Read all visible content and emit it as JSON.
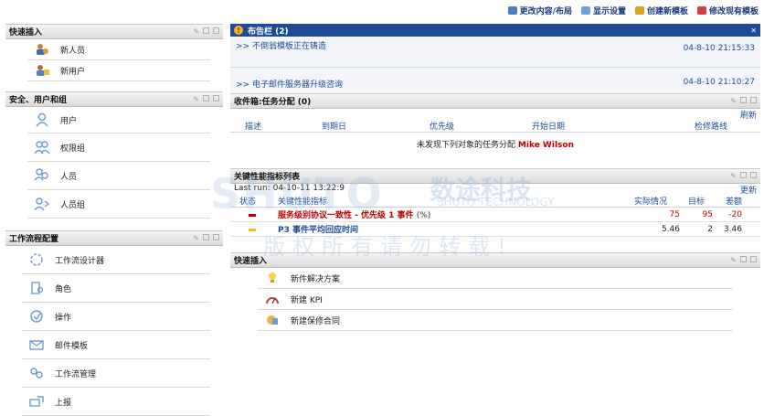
{
  "toplinks": [
    {
      "label": "更改内容/布局",
      "color": "#4a7bc4"
    },
    {
      "label": "显示设置",
      "color": "#6fa0d8"
    },
    {
      "label": "创建新模板",
      "color": "#e0a020"
    },
    {
      "label": "修改现有模板",
      "color": "#d04040"
    }
  ],
  "quick_insert_left": {
    "title": "快速插入",
    "items": [
      {
        "label": "新人员",
        "icon": "new-person-icon"
      },
      {
        "label": "新用户",
        "icon": "new-user-icon"
      }
    ]
  },
  "security": {
    "title": "安全、用户和组",
    "items": [
      {
        "label": "用户",
        "icon": "user-icon"
      },
      {
        "label": "权限组",
        "icon": "permission-group-icon"
      },
      {
        "label": "人员",
        "icon": "person-icon"
      },
      {
        "label": "人员组",
        "icon": "person-group-icon"
      }
    ]
  },
  "workflow": {
    "title": "工作流程配置",
    "items": [
      {
        "label": "工作流设计器",
        "icon": "workflow-designer-icon"
      },
      {
        "label": "角色",
        "icon": "role-icon"
      },
      {
        "label": "操作",
        "icon": "action-icon"
      },
      {
        "label": "邮件模板",
        "icon": "email-template-icon"
      },
      {
        "label": "工作流管理",
        "icon": "workflow-admin-icon"
      },
      {
        "label": "上报",
        "icon": "escalation-icon"
      }
    ]
  },
  "bulletin": {
    "title": "布告栏 (2)",
    "items": [
      {
        "text": ">> 不倒翁模板正在铸造",
        "time": "04-8-10 21:15:33"
      },
      {
        "text": ">> 电子邮件服务器升级咨询",
        "time": "04-8-10 21:10:27"
      }
    ]
  },
  "inbox": {
    "title": "收件箱:任务分配 (0)",
    "refresh": "刷新",
    "columns": [
      "描述",
      "到期日",
      "优先级",
      "开始日期",
      "检修路线"
    ],
    "empty_text": "未发现下列对象的任务分配",
    "user": "Mike Wilson"
  },
  "kpi": {
    "title": "关键性能指标列表",
    "last_run": "Last run: 04-10-11 13:22:9",
    "update": "更新",
    "columns": [
      "状态",
      "关键性能指标",
      "实际情况",
      "目标",
      "差额"
    ],
    "rows": [
      {
        "status_color": "#c00000",
        "name": "服务级别协议一致性 - 优先级 1 事件",
        "unit": "(%)",
        "actual": "75",
        "target": "95",
        "variance": "-20",
        "highlight": true
      },
      {
        "status_color": "#f0c020",
        "name": "P3 事件平均回应时间",
        "unit": "",
        "actual": "5.46",
        "target": "2",
        "variance": "3.46",
        "highlight": false
      }
    ]
  },
  "quick_insert_right": {
    "title": "快速插入",
    "items": [
      {
        "label": "新件解决方案",
        "icon": "lightbulb-icon"
      },
      {
        "label": "新建 KPI",
        "icon": "gauge-icon"
      },
      {
        "label": "新建保修合同",
        "icon": "contract-icon"
      }
    ]
  },
  "watermark": {
    "brand": "SHUTO",
    "cn": "数途科技",
    "en": "SHUTO TECHNOLOGY",
    "notice": "版权所有请勿转载!"
  }
}
